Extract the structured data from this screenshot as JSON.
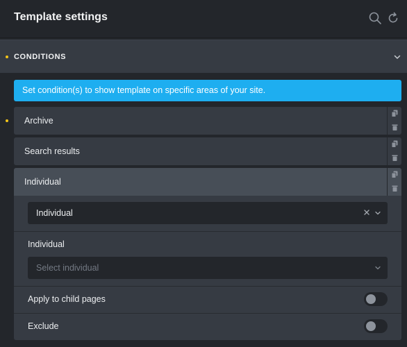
{
  "header": {
    "title": "Template settings",
    "icons": [
      "search-icon",
      "reload-icon"
    ]
  },
  "conditions_section": {
    "title": "CONDITIONS",
    "expanded": true
  },
  "info_banner": {
    "text": "Set condition(s) to show template on specific areas of your site.",
    "color": "#1eaef0"
  },
  "conditions": [
    {
      "label": "Archive"
    },
    {
      "label": "Search results"
    },
    {
      "label": "Individual",
      "expanded": true
    }
  ],
  "individual_panel": {
    "type_select": {
      "value": "Individual"
    },
    "individual_label": "Individual",
    "individual_select": {
      "placeholder": "Select individual"
    },
    "apply_to_child_label": "Apply to child pages",
    "apply_to_child_on": false,
    "exclude_label": "Exclude",
    "exclude_on": false
  },
  "colors": {
    "accent_dot": "#f5c518",
    "background": "#23262b",
    "row": "#363b43",
    "row_active": "#474e57"
  }
}
